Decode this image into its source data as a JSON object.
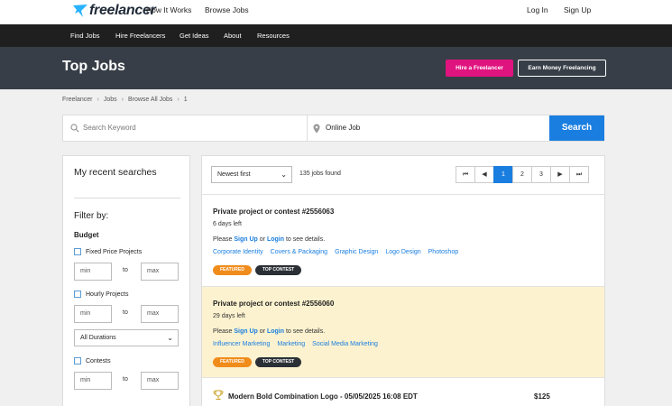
{
  "header": {
    "logo_text": "freelancer",
    "nav_left": [
      "How It Works",
      "Browse Jobs"
    ],
    "login": "Log In",
    "signup": "Sign Up"
  },
  "navbar": {
    "items": [
      "Find Jobs",
      "Hire Freelancers",
      "Get Ideas",
      "About",
      "Resources"
    ]
  },
  "hero": {
    "title": "Top Jobs",
    "hire_button": "Hire a Freelancer",
    "earn_button": "Earn Money Freelancing"
  },
  "breadcrumb": [
    "Freelancer",
    "Jobs",
    "Browse All Jobs",
    "1"
  ],
  "search": {
    "keyword_placeholder": "Search Keyword",
    "location_value": "Online Job",
    "button": "Search"
  },
  "sidebar": {
    "recent_title": "My recent searches",
    "filter_title": "Filter by:",
    "budget_title": "Budget",
    "fixed_label": "Fixed Price Projects",
    "hourly_label": "Hourly Projects",
    "contests_label": "Contests",
    "min_placeholder": "min",
    "max_placeholder": "max",
    "to_label": "to",
    "durations_value": "All Durations"
  },
  "results": {
    "sort_value": "Newest first",
    "count": "135 jobs found",
    "pager": [
      "⏮",
      "◀",
      "1",
      "2",
      "3",
      "▶",
      "⏭"
    ],
    "active_page": "1"
  },
  "jobs": [
    {
      "title": "Private project or contest #2556063",
      "days": "6 days left",
      "details_prefix": "Please",
      "signup": "Sign Up",
      "or": "or",
      "login": "Login",
      "details_suffix": "to see details.",
      "tags": [
        "Corporate Identity",
        "Covers & Packaging",
        "Graphic Design",
        "Logo Design",
        "Photoshop"
      ],
      "badges": [
        "FEATURED",
        "TOP CONTEST"
      ]
    },
    {
      "title": "Private project or contest #2556060",
      "days": "29 days left",
      "details_prefix": "Please",
      "signup": "Sign Up",
      "or": "or",
      "login": "Login",
      "details_suffix": "to see details.",
      "tags": [
        "Influencer Marketing",
        "Marketing",
        "Social Media Marketing"
      ],
      "badges": [
        "FEATURED",
        "TOP CONTEST"
      ]
    },
    {
      "title": "Modern Bold Combination Logo - 05/05/2025 16:08 EDT",
      "price": "$125"
    }
  ],
  "colors": {
    "accent_blue": "#1a7ee0",
    "hire_pink": "#e0147f",
    "featured_orange": "#f08c1c",
    "highlight_yellow": "#fcf2cf"
  }
}
